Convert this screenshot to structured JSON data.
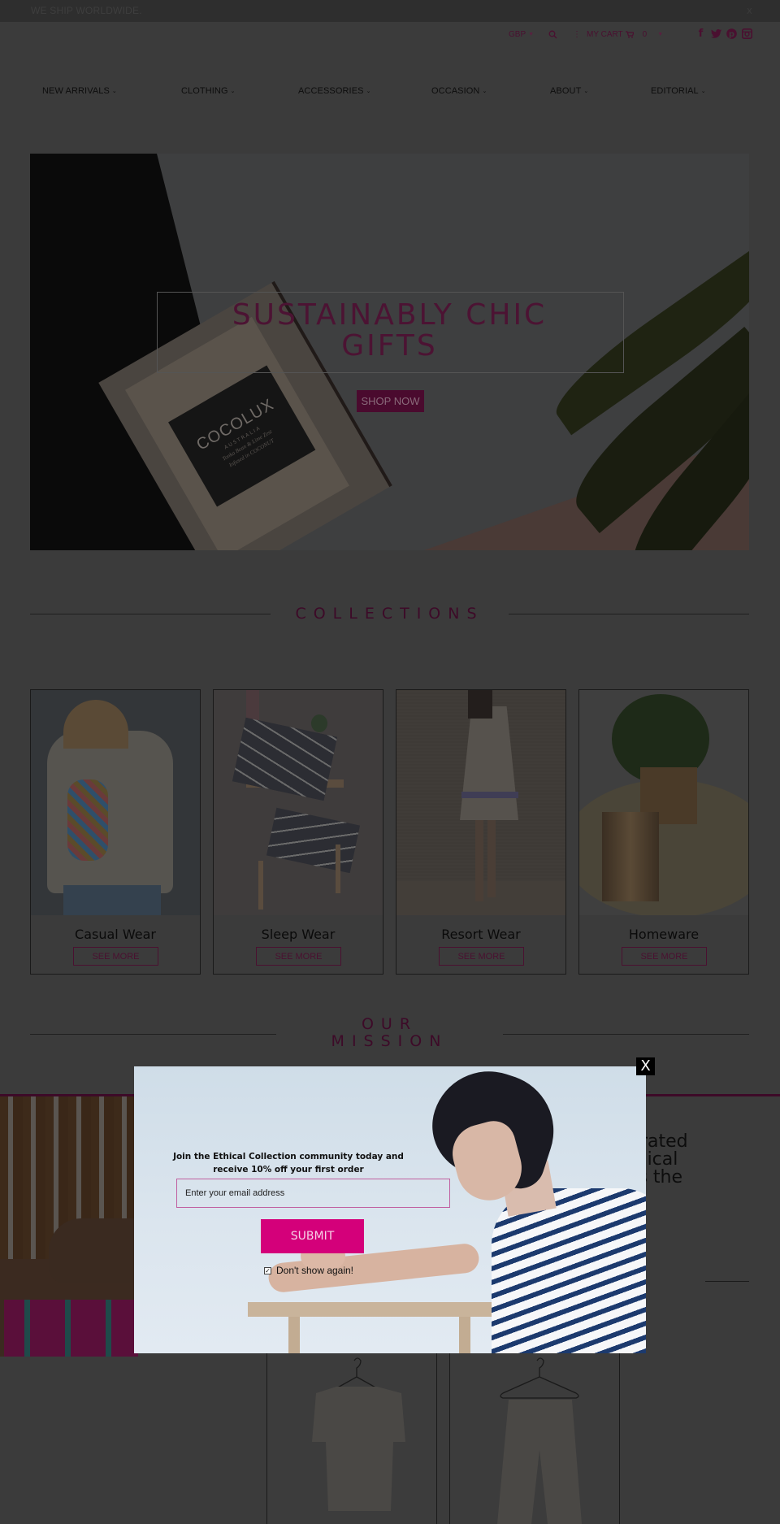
{
  "announcement": {
    "text": "WE SHIP WORLDWIDE.",
    "close_label": "x"
  },
  "utility": {
    "currency": "GBP",
    "cart_label": "MY CART",
    "cart_count": "0",
    "social": [
      "facebook",
      "twitter",
      "pinterest",
      "instagram"
    ]
  },
  "nav": {
    "items": [
      {
        "label": "NEW ARRIVALS"
      },
      {
        "label": "CLOTHING"
      },
      {
        "label": "ACCESSORIES"
      },
      {
        "label": "OCCASION"
      },
      {
        "label": "ABOUT"
      },
      {
        "label": "EDITORIAL"
      }
    ]
  },
  "hero": {
    "title_line1": "SUSTAINABLY CHIC",
    "title_line2": "GIFTS",
    "cta": "SHOP NOW",
    "product_brand": "COCOLUX",
    "product_sub": "AUSTRALIA",
    "product_line1": "Tonka Bean & Lime Zest",
    "product_line2": "Infused in COCONUT"
  },
  "collections": {
    "heading": "COLLECTIONS",
    "cards": [
      {
        "name": "Casual Wear",
        "cta": "SEE MORE"
      },
      {
        "name": "Sleep Wear",
        "cta": "SEE MORE"
      },
      {
        "name": "Resort Wear",
        "cta": "SEE MORE"
      },
      {
        "name": "Homeware",
        "cta": "SEE MORE"
      }
    ]
  },
  "mission": {
    "heading_line1": "OUR",
    "heading_line2": "MISSION",
    "text_partial": "urated\nthical\nss the"
  },
  "popup": {
    "headline": "Join the Ethical Collection community today and receive 10% off your first order",
    "email_placeholder": "Enter your email address",
    "submit_label": "SUBMIT",
    "dont_show_label": "Don't show again!",
    "dont_show_checked": true,
    "close_label": "X"
  },
  "colors": {
    "accent": "#d4007a",
    "brand_dark": "#4a1030",
    "overlay": "#3b3b3b"
  }
}
